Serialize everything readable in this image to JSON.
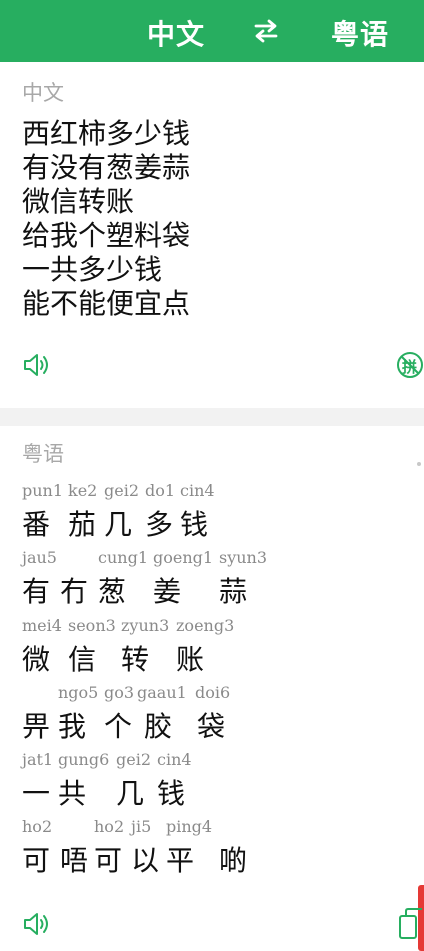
{
  "header": {
    "source_lang": "中文",
    "target_lang": "粤语",
    "accent_color": "#27ae60",
    "swap_icon": "swap-arrows-icon"
  },
  "source": {
    "label": "中文",
    "lines": [
      "西红柿多少钱",
      "有没有葱姜蒜",
      "微信转账",
      "给我个塑料袋",
      "一共多少钱",
      "能不能便宜点"
    ],
    "speak_icon": "speaker-icon",
    "pinyin_icon": "pinyin-toggle-icon",
    "pinyin_glyph": "拼"
  },
  "target": {
    "label": "粤语",
    "rows": [
      {
        "jyutping": [
          "pun1",
          "ke2",
          "gei2",
          "do1",
          "cin4"
        ],
        "chars": [
          "番",
          "茄",
          "几",
          "多",
          "钱"
        ]
      },
      {
        "jyutping": [
          "jau5",
          "",
          "cung1",
          "goeng1",
          "syun3"
        ],
        "chars": [
          "有",
          "冇",
          "葱",
          "姜",
          "蒜"
        ]
      },
      {
        "jyutping": [
          "mei4",
          "seon3",
          "zyun3",
          "zoeng3"
        ],
        "chars": [
          "微",
          "信",
          "转",
          "账"
        ]
      },
      {
        "jyutping": [
          "",
          "ngo5",
          "go3",
          "gaau1",
          "doi6"
        ],
        "chars": [
          "畀",
          "我",
          "个",
          "胶",
          "袋"
        ]
      },
      {
        "jyutping": [
          "jat1",
          "gung6",
          "gei2",
          "cin4"
        ],
        "chars": [
          "一",
          "共",
          "几",
          "钱"
        ]
      },
      {
        "jyutping": [
          "ho2",
          "",
          "ho2",
          "ji5",
          "ping4",
          ""
        ],
        "chars": [
          "可",
          "唔",
          "可",
          "以",
          "平",
          "啲"
        ]
      }
    ],
    "speak_icon": "speaker-icon",
    "copy_icon": "copy-icon"
  }
}
